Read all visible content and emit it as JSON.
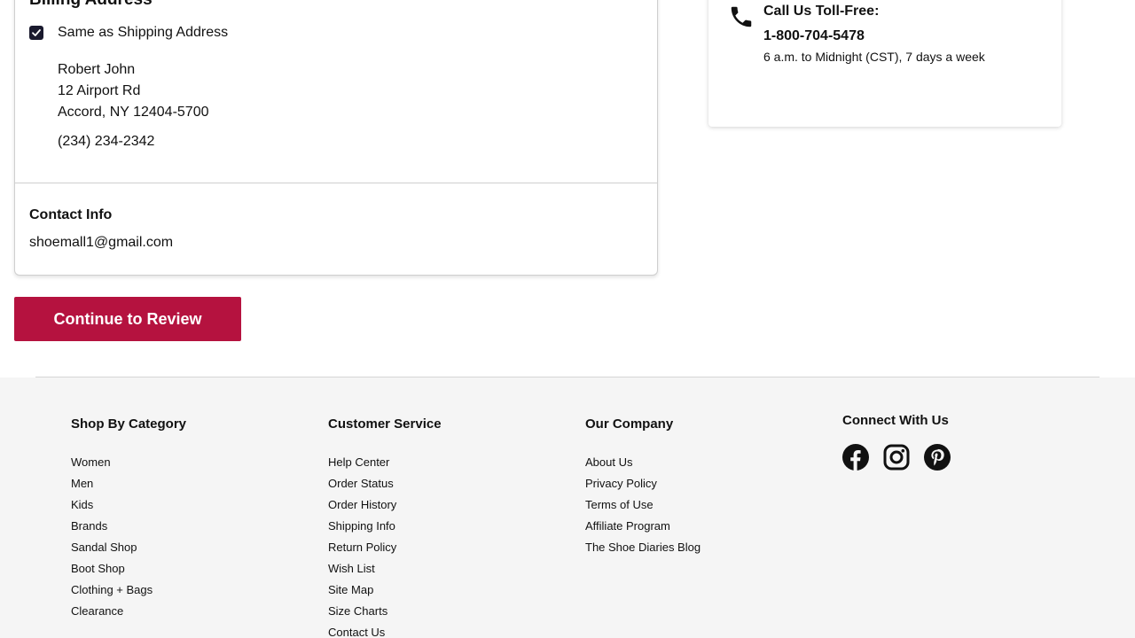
{
  "billing": {
    "title": "Billing Address",
    "same_as_shipping_label": "Same as Shipping Address",
    "name": "Robert John",
    "street": "12 Airport Rd",
    "city_state_zip": "Accord, NY 12404-5700",
    "phone": "(234) 234-2342"
  },
  "contact": {
    "title": "Contact Info",
    "email": "shoemall1@gmail.com"
  },
  "continue_button_label": "Continue to Review",
  "help": {
    "call_title": "Call Us Toll-Free:",
    "phone_number": "1-800-704-5478",
    "hours": "6 a.m. to Midnight (CST), 7 days a week"
  },
  "footer": {
    "shop": {
      "title": "Shop By Category",
      "items": [
        "Women",
        "Men",
        "Kids",
        "Brands",
        "Sandal Shop",
        "Boot Shop",
        "Clothing + Bags",
        "Clearance"
      ]
    },
    "service": {
      "title": "Customer Service",
      "items": [
        "Help Center",
        "Order Status",
        "Order History",
        "Shipping Info",
        "Return Policy",
        "Wish List",
        "Site Map",
        "Size Charts",
        "Contact Us"
      ]
    },
    "company": {
      "title": "Our Company",
      "items": [
        "About Us",
        "Privacy Policy",
        "Terms of Use",
        "Affiliate Program",
        "The Shoe Diaries Blog"
      ]
    },
    "connect": {
      "title": "Connect With Us",
      "icons": [
        "facebook-icon",
        "instagram-icon",
        "pinterest-icon"
      ]
    }
  },
  "colors": {
    "accent": "#b5123f",
    "checkbox": "#1a1a2e",
    "footer_bg": "#f5f5f5"
  }
}
